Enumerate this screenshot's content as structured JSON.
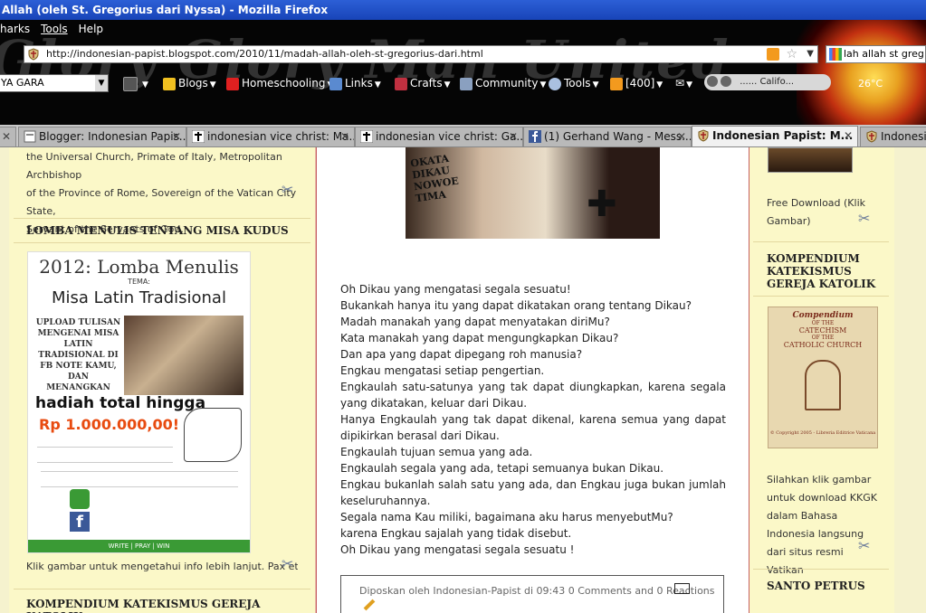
{
  "window": {
    "title": "Allah (oleh St. Gregorius dari Nyssa) - Mozilla Firefox"
  },
  "persona": {
    "text": "Glory Glory Man United"
  },
  "menubar": {
    "items": [
      "harks",
      "Tools",
      "Help"
    ]
  },
  "urlbar": {
    "url": "http://indonesian-papist.blogspot.com/2010/11/madah-allah-oleh-st-gregorius-dari.html"
  },
  "searchbox": {
    "value": "lah allah st greg"
  },
  "toolbar": {
    "select_value": "YA GARA",
    "items": [
      {
        "label": "Blogs",
        "icon": "star-icon"
      },
      {
        "label": "Homeschooling",
        "icon": "heart-icon"
      },
      {
        "label": "Links",
        "icon": "computer-icon"
      },
      {
        "label": "Crafts",
        "icon": "scissors-icon"
      },
      {
        "label": "Community",
        "icon": "people-icon"
      },
      {
        "label": "Tools",
        "icon": "magnifier-icon"
      },
      {
        "label": "[400]",
        "icon": "rss-icon"
      }
    ],
    "media_label": "...... Califo...",
    "weather": "26°C"
  },
  "tabs": [
    {
      "label": "",
      "active": false
    },
    {
      "label": "Blogger: Indonesian Papis...",
      "active": false,
      "icon": "blogger-icon"
    },
    {
      "label": "indonesian vice christ: Ma...",
      "active": false,
      "icon": "cross-icon"
    },
    {
      "label": "indonesian vice christ: Ga...",
      "active": false,
      "icon": "cross-icon"
    },
    {
      "label": "(1) Gerhand Wang - Mess...",
      "active": false,
      "icon": "facebook-icon"
    },
    {
      "label": "Indonesian Papist: M...",
      "active": true,
      "icon": "shield-icon"
    },
    {
      "label": "Indonesia",
      "active": false,
      "icon": "shield-icon"
    }
  ],
  "left_sidebar": {
    "intro_lines": [
      "the Universal Church, Primate of Italy, Metropolitan Archbishop",
      "of the Province of Rome, Sovereign of the Vatican City State,",
      "Servant of the Servants of God."
    ],
    "widget1_title": "LOMBA MENULIS TENTANG MISA KUDUS",
    "poster": {
      "title": "2012: Lomba Menulis",
      "tema": "TEMA:",
      "subtitle": "Misa Latin Tradisional",
      "upload_lines": [
        "UPLOAD TULISAN",
        "MENGENAI MISA",
        "LATIN",
        "TRADISIONAL DI",
        "FB NOTE KAMU,",
        "DAN MENANGKAN"
      ],
      "prize_label": "hadiah total hingga",
      "prize_amount": "Rp 1.000.000,00!",
      "footer": "WRITE | PRAY | WIN"
    },
    "caption": "Klik gambar untuk mengetahui info lebih lanjut. Pax et Bonum",
    "widget2_title": "KOMPENDIUM KATEKISMUS GEREJA KATOLIK"
  },
  "post": {
    "image_text": [
      "OKATA",
      "DIKAU",
      "NOWOE",
      "TIMA"
    ],
    "lines": [
      "Oh Dikau yang mengatasi segala sesuatu!",
      "Bukankah hanya itu yang dapat dikatakan orang tentang Dikau?",
      "Madah manakah yang dapat menyatakan diriMu?",
      "Kata manakah yang dapat mengungkapkan Dikau?",
      "Dan apa yang dapat dipegang roh manusia?",
      "Engkau mengatasi setiap pengertian.",
      "Engkaulah satu-satunya yang tak dapat diungkapkan, karena segala yang dikatakan, keluar dari Dikau.",
      "Hanya Engkaulah yang tak dapat dikenal, karena semua yang dapat dipikirkan berasal dari Dikau.",
      "Engkaulah tujuan semua yang ada.",
      "Engkaulah segala yang ada, tetapi semuanya bukan Dikau.",
      "Engkau bukanlah salah satu yang ada, dan Engkau juga bukan jumlah keseluruhannya.",
      "Segala nama Kau miliki, bagaimana aku harus menyebutMu?",
      "karena Engkau sajalah yang tidak disebut.",
      "Oh Dikau yang mengatasi segala sesuatu !"
    ],
    "footer_meta": "Diposkan oleh Indonesian-Papist di 09:43 0 Comments and 0 Reactions"
  },
  "right_sidebar": {
    "free_download": "Free Download (Klik Gambar)",
    "widget_title": "KOMPENDIUM KATEKISMUS GEREJA KATOLIK",
    "book": {
      "title": "Compendium",
      "of_the": "OF THE",
      "line2": "CATECHISM",
      "line3": "OF THE",
      "line4": "CATHOLIC CHURCH",
      "copyright": "© Copyright 2005 - Libreria Editrice Vaticana"
    },
    "caption": "Silahkan klik gambar untuk download KKGK dalam Bahasa Indonesia langsung dari situs resmi Vatikan",
    "widget2_title": "SANTO PETRUS"
  },
  "colors": {
    "titlebar": "#1844b8",
    "main_border": "#c76060",
    "sidebar_bg": "#fbf8c8",
    "prize_red": "#e84b10",
    "poster_green": "#3a9a35"
  }
}
